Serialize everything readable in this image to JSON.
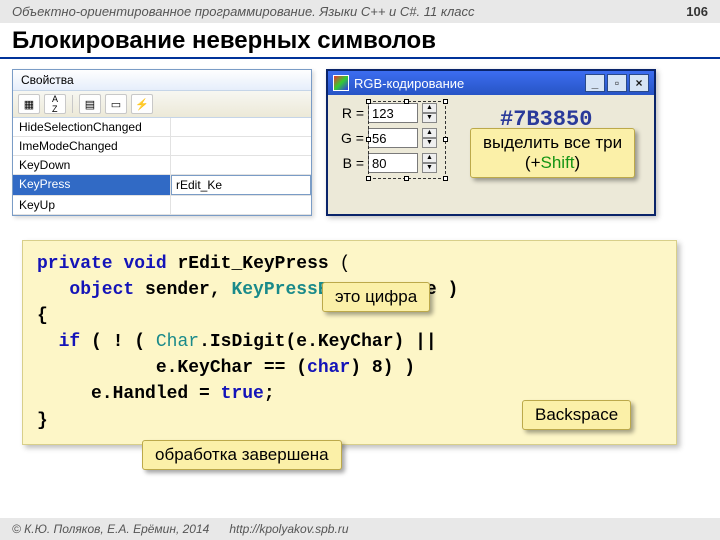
{
  "header": {
    "course": "Объектно-ориентированное программирование. Языки C++ и C#. 11 класс",
    "page": "106"
  },
  "title": "Блокирование неверных символов",
  "props": {
    "title": "Свойства",
    "toolbar_icons": [
      "cat-icon",
      "az-icon",
      "grid-icon",
      "page-icon",
      "lightning-icon"
    ],
    "rows": [
      {
        "name": "HideSelectionChanged",
        "val": ""
      },
      {
        "name": "ImeModeChanged",
        "val": ""
      },
      {
        "name": "KeyDown",
        "val": ""
      },
      {
        "name": "KeyPress",
        "val": "rEdit_Ke",
        "selected": true
      },
      {
        "name": "KeyUp",
        "val": ""
      }
    ]
  },
  "rgb": {
    "title": "RGB-кодирование",
    "r_label": "R =",
    "r_val": "123",
    "g_label": "G =",
    "g_val": "56",
    "b_label": "B =",
    "b_val": "80",
    "hex": "#7B3850"
  },
  "callouts": {
    "shift_line1": "выделить все три",
    "shift_line2_prefix": "(+",
    "shift_line2_key": "Shift",
    "shift_line2_suffix": ")",
    "digit": "это цифра",
    "backspace": "Backspace",
    "handled": "обработка завершена"
  },
  "code": {
    "l1a": "private",
    "l1b": "void",
    "l1c": "rEdit_KeyPress",
    "l1d": " (",
    "l2a": "object",
    "l2b": " sender, ",
    "l2c": "KeyPressEventArgs",
    "l2d": " e )",
    "l3": "{",
    "l4a": "if",
    "l4b": " ( ! ( ",
    "l4c": "Char",
    "l4d": ".IsDigit(e.KeyChar) ||",
    "l5a": "           e.KeyChar == (",
    "l5b": "char",
    "l5c": ") 8) )",
    "l6a": "     e.Handled = ",
    "l6b": "true",
    "l6c": ";",
    "l7": "}"
  },
  "footer": {
    "copyright": "© К.Ю. Поляков, Е.А. Ерёмин, 2014",
    "url": "http://kpolyakov.spb.ru"
  }
}
